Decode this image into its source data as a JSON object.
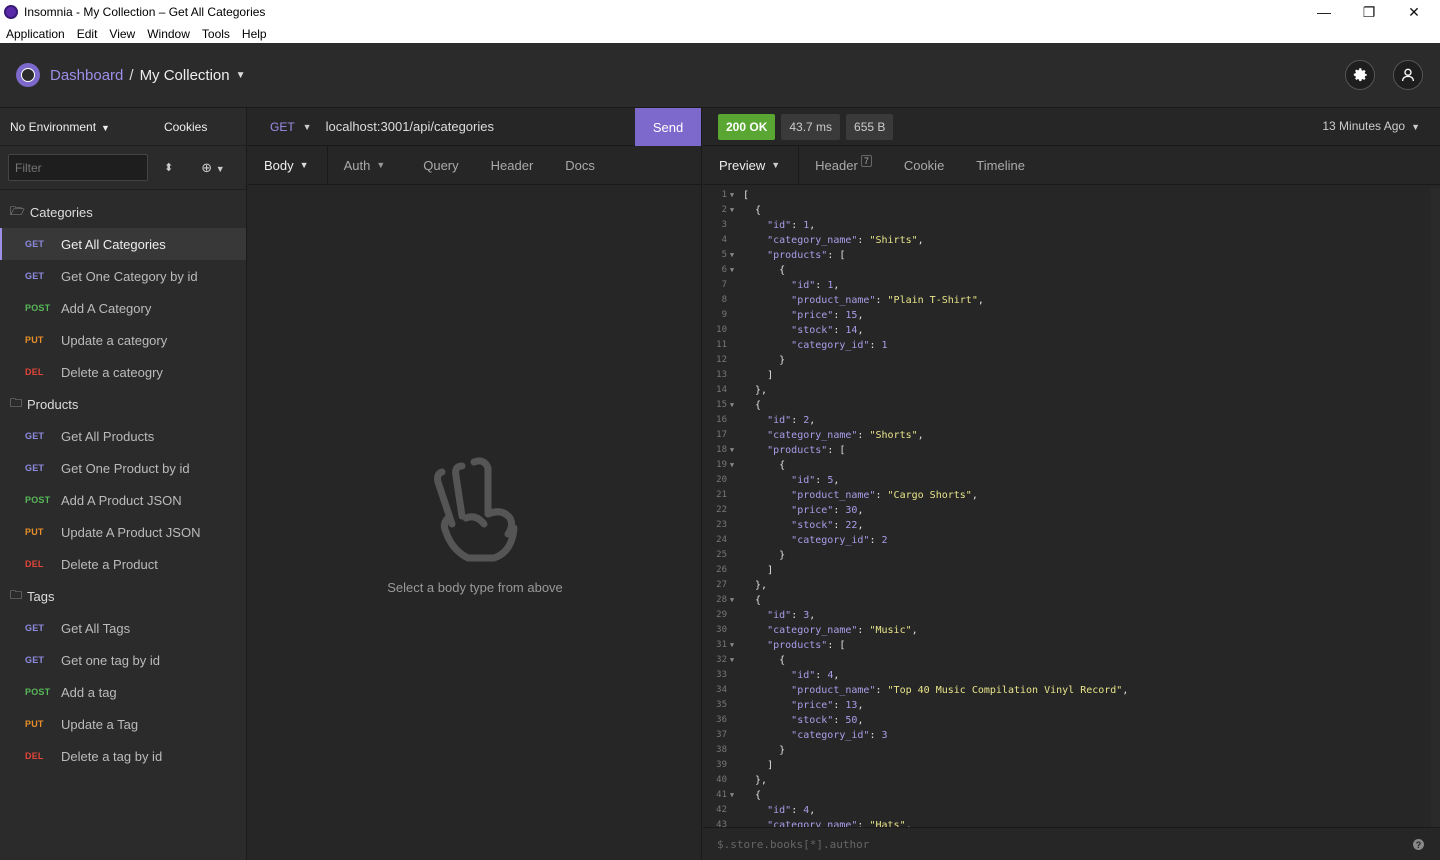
{
  "window": {
    "title": "Insomnia - My Collection – Get All Categories",
    "controls": {
      "minimize": "—",
      "restore": "❐",
      "close": "✕"
    }
  },
  "menu": [
    "Application",
    "Edit",
    "View",
    "Window",
    "Tools",
    "Help"
  ],
  "header": {
    "dashboard": "Dashboard",
    "separator": "/",
    "collection": "My Collection",
    "settings_icon": "gear-icon",
    "account_icon": "user-icon"
  },
  "sidebar": {
    "environment": "No Environment",
    "cookies": "Cookies",
    "filter_placeholder": "Filter",
    "folders": [
      {
        "name": "Categories",
        "requests": [
          {
            "method": "GET",
            "name": "Get All Categories",
            "active": true
          },
          {
            "method": "GET",
            "name": "Get One Category by id"
          },
          {
            "method": "POST",
            "name": "Add A Category"
          },
          {
            "method": "PUT",
            "name": "Update a category"
          },
          {
            "method": "DEL",
            "name": "Delete a cateogry"
          }
        ]
      },
      {
        "name": "Products",
        "requests": [
          {
            "method": "GET",
            "name": "Get All Products"
          },
          {
            "method": "GET",
            "name": "Get One Product by id"
          },
          {
            "method": "POST",
            "name": "Add A Product JSON"
          },
          {
            "method": "PUT",
            "name": "Update A Product JSON"
          },
          {
            "method": "DEL",
            "name": "Delete a Product"
          }
        ]
      },
      {
        "name": "Tags",
        "requests": [
          {
            "method": "GET",
            "name": "Get All Tags"
          },
          {
            "method": "GET",
            "name": "Get one tag by id"
          },
          {
            "method": "POST",
            "name": "Add a tag"
          },
          {
            "method": "PUT",
            "name": "Update a Tag"
          },
          {
            "method": "DEL",
            "name": "Delete a tag by id"
          }
        ]
      }
    ]
  },
  "request": {
    "method": "GET",
    "url": "localhost:3001/api/categories",
    "send": "Send",
    "tabs": [
      "Body",
      "Auth",
      "Query",
      "Header",
      "Docs"
    ],
    "empty_text": "Select a body type from above"
  },
  "response": {
    "status": "200 OK",
    "time": "43.7 ms",
    "size": "655 B",
    "ago": "13 Minutes Ago",
    "tabs": [
      "Preview",
      "Header",
      "Cookie",
      "Timeline"
    ],
    "header_count": "7",
    "filter_placeholder": "$.store.books[*].author",
    "help": "?",
    "lines": [
      "[",
      "  {",
      "    \"id\": 1,",
      "    \"category_name\": \"Shirts\",",
      "    \"products\": [",
      "      {",
      "        \"id\": 1,",
      "        \"product_name\": \"Plain T-Shirt\",",
      "        \"price\": 15,",
      "        \"stock\": 14,",
      "        \"category_id\": 1",
      "      }",
      "    ]",
      "  },",
      "  {",
      "    \"id\": 2,",
      "    \"category_name\": \"Shorts\",",
      "    \"products\": [",
      "      {",
      "        \"id\": 5,",
      "        \"product_name\": \"Cargo Shorts\",",
      "        \"price\": 30,",
      "        \"stock\": 22,",
      "        \"category_id\": 2",
      "      }",
      "    ]",
      "  },",
      "  {",
      "    \"id\": 3,",
      "    \"category_name\": \"Music\",",
      "    \"products\": [",
      "      {",
      "        \"id\": 4,",
      "        \"product_name\": \"Top 40 Music Compilation Vinyl Record\",",
      "        \"price\": 13,",
      "        \"stock\": 50,",
      "        \"category_id\": 3",
      "      }",
      "    ]",
      "  },",
      "  {",
      "    \"id\": 4,",
      "    \"category_name\": \"Hats\","
    ],
    "fold_lines": [
      1,
      2,
      5,
      6,
      15,
      18,
      19,
      28,
      31,
      32,
      41
    ]
  }
}
